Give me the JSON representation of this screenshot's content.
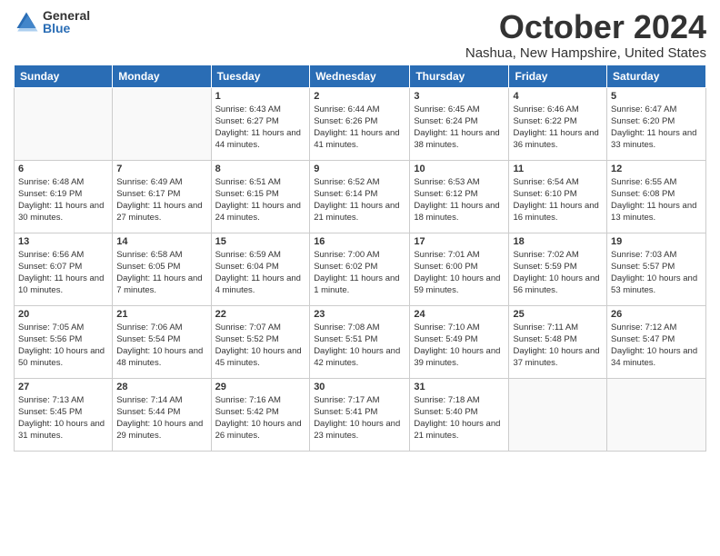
{
  "logo": {
    "general": "General",
    "blue": "Blue"
  },
  "title": "October 2024",
  "location": "Nashua, New Hampshire, United States",
  "weekdays": [
    "Sunday",
    "Monday",
    "Tuesday",
    "Wednesday",
    "Thursday",
    "Friday",
    "Saturday"
  ],
  "weeks": [
    [
      {
        "day": "",
        "info": ""
      },
      {
        "day": "",
        "info": ""
      },
      {
        "day": "1",
        "info": "Sunrise: 6:43 AM\nSunset: 6:27 PM\nDaylight: 11 hours and 44 minutes."
      },
      {
        "day": "2",
        "info": "Sunrise: 6:44 AM\nSunset: 6:26 PM\nDaylight: 11 hours and 41 minutes."
      },
      {
        "day": "3",
        "info": "Sunrise: 6:45 AM\nSunset: 6:24 PM\nDaylight: 11 hours and 38 minutes."
      },
      {
        "day": "4",
        "info": "Sunrise: 6:46 AM\nSunset: 6:22 PM\nDaylight: 11 hours and 36 minutes."
      },
      {
        "day": "5",
        "info": "Sunrise: 6:47 AM\nSunset: 6:20 PM\nDaylight: 11 hours and 33 minutes."
      }
    ],
    [
      {
        "day": "6",
        "info": "Sunrise: 6:48 AM\nSunset: 6:19 PM\nDaylight: 11 hours and 30 minutes."
      },
      {
        "day": "7",
        "info": "Sunrise: 6:49 AM\nSunset: 6:17 PM\nDaylight: 11 hours and 27 minutes."
      },
      {
        "day": "8",
        "info": "Sunrise: 6:51 AM\nSunset: 6:15 PM\nDaylight: 11 hours and 24 minutes."
      },
      {
        "day": "9",
        "info": "Sunrise: 6:52 AM\nSunset: 6:14 PM\nDaylight: 11 hours and 21 minutes."
      },
      {
        "day": "10",
        "info": "Sunrise: 6:53 AM\nSunset: 6:12 PM\nDaylight: 11 hours and 18 minutes."
      },
      {
        "day": "11",
        "info": "Sunrise: 6:54 AM\nSunset: 6:10 PM\nDaylight: 11 hours and 16 minutes."
      },
      {
        "day": "12",
        "info": "Sunrise: 6:55 AM\nSunset: 6:08 PM\nDaylight: 11 hours and 13 minutes."
      }
    ],
    [
      {
        "day": "13",
        "info": "Sunrise: 6:56 AM\nSunset: 6:07 PM\nDaylight: 11 hours and 10 minutes."
      },
      {
        "day": "14",
        "info": "Sunrise: 6:58 AM\nSunset: 6:05 PM\nDaylight: 11 hours and 7 minutes."
      },
      {
        "day": "15",
        "info": "Sunrise: 6:59 AM\nSunset: 6:04 PM\nDaylight: 11 hours and 4 minutes."
      },
      {
        "day": "16",
        "info": "Sunrise: 7:00 AM\nSunset: 6:02 PM\nDaylight: 11 hours and 1 minute."
      },
      {
        "day": "17",
        "info": "Sunrise: 7:01 AM\nSunset: 6:00 PM\nDaylight: 10 hours and 59 minutes."
      },
      {
        "day": "18",
        "info": "Sunrise: 7:02 AM\nSunset: 5:59 PM\nDaylight: 10 hours and 56 minutes."
      },
      {
        "day": "19",
        "info": "Sunrise: 7:03 AM\nSunset: 5:57 PM\nDaylight: 10 hours and 53 minutes."
      }
    ],
    [
      {
        "day": "20",
        "info": "Sunrise: 7:05 AM\nSunset: 5:56 PM\nDaylight: 10 hours and 50 minutes."
      },
      {
        "day": "21",
        "info": "Sunrise: 7:06 AM\nSunset: 5:54 PM\nDaylight: 10 hours and 48 minutes."
      },
      {
        "day": "22",
        "info": "Sunrise: 7:07 AM\nSunset: 5:52 PM\nDaylight: 10 hours and 45 minutes."
      },
      {
        "day": "23",
        "info": "Sunrise: 7:08 AM\nSunset: 5:51 PM\nDaylight: 10 hours and 42 minutes."
      },
      {
        "day": "24",
        "info": "Sunrise: 7:10 AM\nSunset: 5:49 PM\nDaylight: 10 hours and 39 minutes."
      },
      {
        "day": "25",
        "info": "Sunrise: 7:11 AM\nSunset: 5:48 PM\nDaylight: 10 hours and 37 minutes."
      },
      {
        "day": "26",
        "info": "Sunrise: 7:12 AM\nSunset: 5:47 PM\nDaylight: 10 hours and 34 minutes."
      }
    ],
    [
      {
        "day": "27",
        "info": "Sunrise: 7:13 AM\nSunset: 5:45 PM\nDaylight: 10 hours and 31 minutes."
      },
      {
        "day": "28",
        "info": "Sunrise: 7:14 AM\nSunset: 5:44 PM\nDaylight: 10 hours and 29 minutes."
      },
      {
        "day": "29",
        "info": "Sunrise: 7:16 AM\nSunset: 5:42 PM\nDaylight: 10 hours and 26 minutes."
      },
      {
        "day": "30",
        "info": "Sunrise: 7:17 AM\nSunset: 5:41 PM\nDaylight: 10 hours and 23 minutes."
      },
      {
        "day": "31",
        "info": "Sunrise: 7:18 AM\nSunset: 5:40 PM\nDaylight: 10 hours and 21 minutes."
      },
      {
        "day": "",
        "info": ""
      },
      {
        "day": "",
        "info": ""
      }
    ]
  ]
}
